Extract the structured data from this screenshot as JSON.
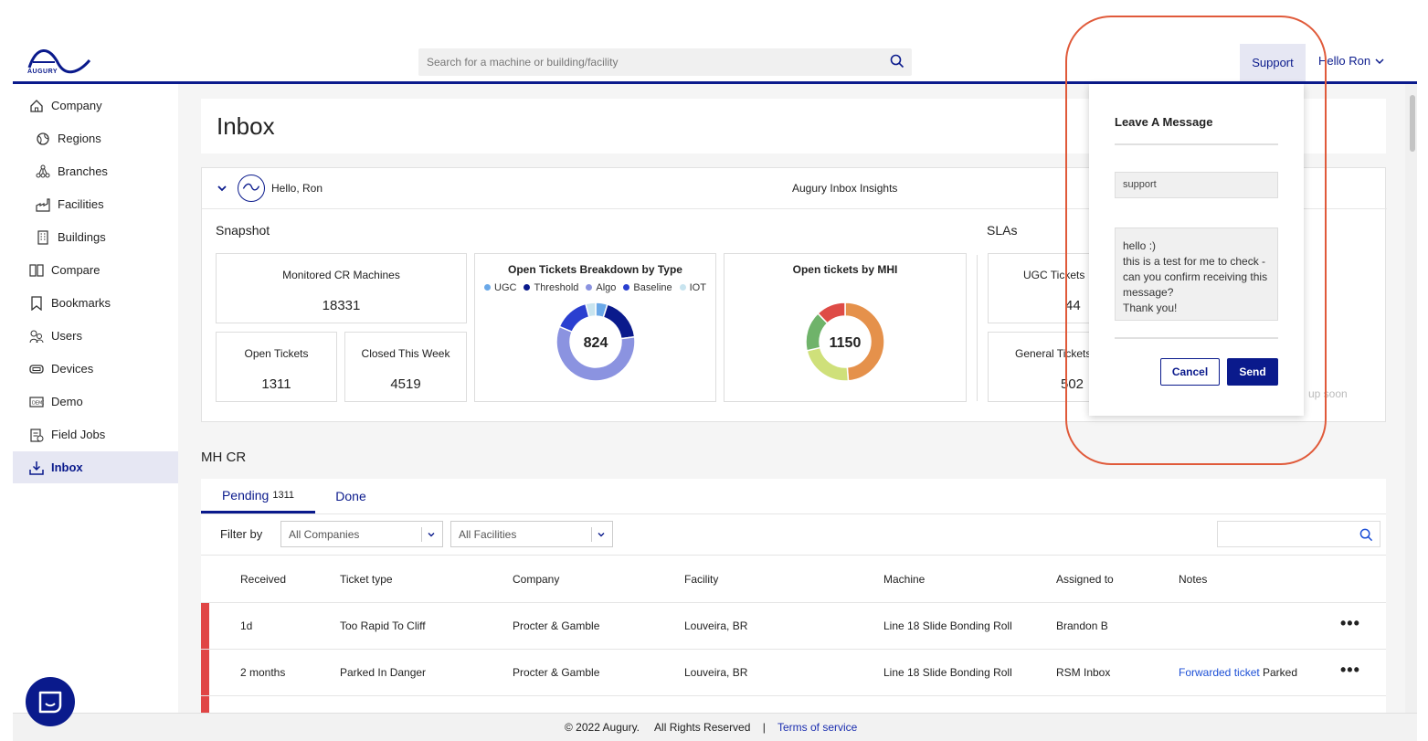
{
  "header": {
    "logo_text": "AUGURY",
    "search_placeholder": "Search for a machine or building/facility",
    "support_label": "Support",
    "user_greeting": "Hello Ron"
  },
  "sidebar": {
    "items": [
      {
        "label": "Company",
        "icon": "home-icon"
      },
      {
        "label": "Regions",
        "icon": "globe-icon"
      },
      {
        "label": "Branches",
        "icon": "branches-icon"
      },
      {
        "label": "Facilities",
        "icon": "factory-icon"
      },
      {
        "label": "Buildings",
        "icon": "building-icon"
      },
      {
        "label": "Compare",
        "icon": "compare-icon"
      },
      {
        "label": "Bookmarks",
        "icon": "bookmark-icon"
      },
      {
        "label": "Users",
        "icon": "users-icon"
      },
      {
        "label": "Devices",
        "icon": "device-icon"
      },
      {
        "label": "Demo",
        "icon": "demo-icon"
      },
      {
        "label": "Field Jobs",
        "icon": "clipboard-icon"
      },
      {
        "label": "Inbox",
        "icon": "inbox-icon",
        "active": true
      }
    ]
  },
  "page": {
    "title": "Inbox"
  },
  "insights": {
    "greeting": "Hello, Ron",
    "title": "Augury Inbox Insights",
    "snapshot_label": "Snapshot",
    "slas_label": "SLAs",
    "stats": {
      "monitored_label": "Monitored CR Machines",
      "monitored_value": "18331",
      "open_label": "Open Tickets",
      "open_value": "1311",
      "closed_label": "Closed This Week",
      "closed_value": "4519"
    },
    "sla_stats": {
      "ugc_label": "UGC Tickets",
      "ugc_value": "44",
      "general_label": "General Tickets",
      "general_value": "502"
    },
    "coming_soon": "up soon"
  },
  "chart_data": [
    {
      "type": "pie",
      "title": "Open Tickets Breakdown by Type",
      "center_label": "824",
      "categories": [
        "UGC",
        "Threshold",
        "Algo",
        "Baseline",
        "IOT"
      ],
      "values": [
        40,
        150,
        480,
        120,
        34
      ],
      "colors": [
        "#6aa8e8",
        "#0a1a8c",
        "#8b93e0",
        "#2a3fd0",
        "#c8e4ef"
      ],
      "legend": "top"
    },
    {
      "type": "pie",
      "title": "Open tickets by MHI",
      "center_label": "1150",
      "categories": [
        "orange",
        "yellow-green",
        "green",
        "red"
      ],
      "values": [
        560,
        260,
        190,
        140
      ],
      "colors": [
        "#e5914b",
        "#cfe07a",
        "#6fb36a",
        "#de4b46"
      ]
    }
  ],
  "section": {
    "title": "MH CR"
  },
  "tabs": {
    "pending_label": "Pending",
    "pending_count": "1311",
    "done_label": "Done"
  },
  "filters": {
    "label": "Filter by",
    "company": "All Companies",
    "facility": "All Facilities"
  },
  "table": {
    "columns": [
      "Received",
      "Ticket type",
      "Company",
      "Facility",
      "Machine",
      "Assigned to",
      "Notes"
    ],
    "rows": [
      {
        "received": "1d",
        "type": "Too Rapid To Cliff",
        "company": "Procter & Gamble",
        "facility": "Louveira, BR",
        "machine": "Line 18 Slide Bonding Roll",
        "assigned": "Brandon B",
        "notes_link": "",
        "notes": ""
      },
      {
        "received": "2 months",
        "type": "Parked In Danger",
        "company": "Procter & Gamble",
        "facility": "Louveira, BR",
        "machine": "Line 18 Slide Bonding Roll",
        "assigned": "RSM Inbox",
        "notes_link": "Forwarded ticket",
        "notes": "Parked"
      }
    ]
  },
  "footer": {
    "copyright": "© 2022 Augury.",
    "rights": "All Rights Reserved",
    "separator": "|",
    "terms": "Terms of service"
  },
  "support_popup": {
    "title": "Leave A Message",
    "subject": "support",
    "message": "hello :)\nthis is a test for me to check - can you confirm receiving this message?\nThank you!",
    "cancel": "Cancel",
    "send": "Send"
  }
}
